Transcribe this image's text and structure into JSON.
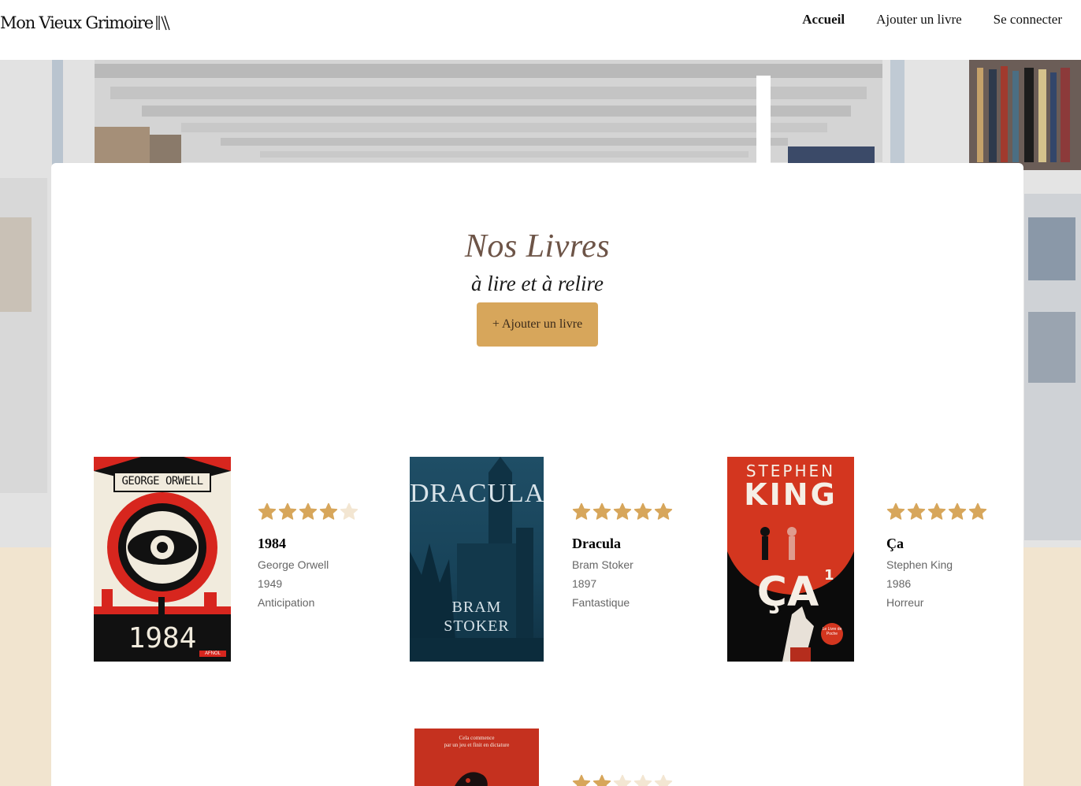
{
  "header": {
    "logo_text": "Mon Vieux Grimoire",
    "nav": [
      "Accueil",
      "Ajouter un livre",
      "Se connecter"
    ]
  },
  "main": {
    "title": "Nos Livres",
    "subtitle": "à lire et à relire",
    "add_button": "+ Ajouter un livre"
  },
  "books": [
    {
      "title": "1984",
      "author": "George Orwell",
      "year": "1949",
      "genre": "Anticipation",
      "rating": 4,
      "cover": {
        "top": "GEORGE ORWELL",
        "bottom": "1984",
        "publisher": "AFNOL"
      }
    },
    {
      "title": "Dracula",
      "author": "Bram Stoker",
      "year": "1897",
      "genre": "Fantastique",
      "rating": 5,
      "cover": {
        "top": "DRACULA",
        "bottom_1": "BRAM",
        "bottom_2": "STOKER"
      }
    },
    {
      "title": "Ça",
      "author": "Stephen King",
      "year": "1986",
      "genre": "Horreur",
      "rating": 5,
      "cover": {
        "top_1": "STEPHEN",
        "top_2": "KING",
        "bottom": "ÇA",
        "volume": "1",
        "publisher": "Le Livre de Poche"
      }
    },
    {
      "rating": 2,
      "cover": {
        "top_1": "Cela commence",
        "top_2": "par un jeu et finit en dictature"
      }
    }
  ],
  "colors": {
    "accent": "#d7a65b",
    "star_filled": "#d7a65b",
    "star_empty": "#f3e6d2",
    "title_brown": "#6d5447",
    "beige_bg": "#f1e4cf"
  }
}
